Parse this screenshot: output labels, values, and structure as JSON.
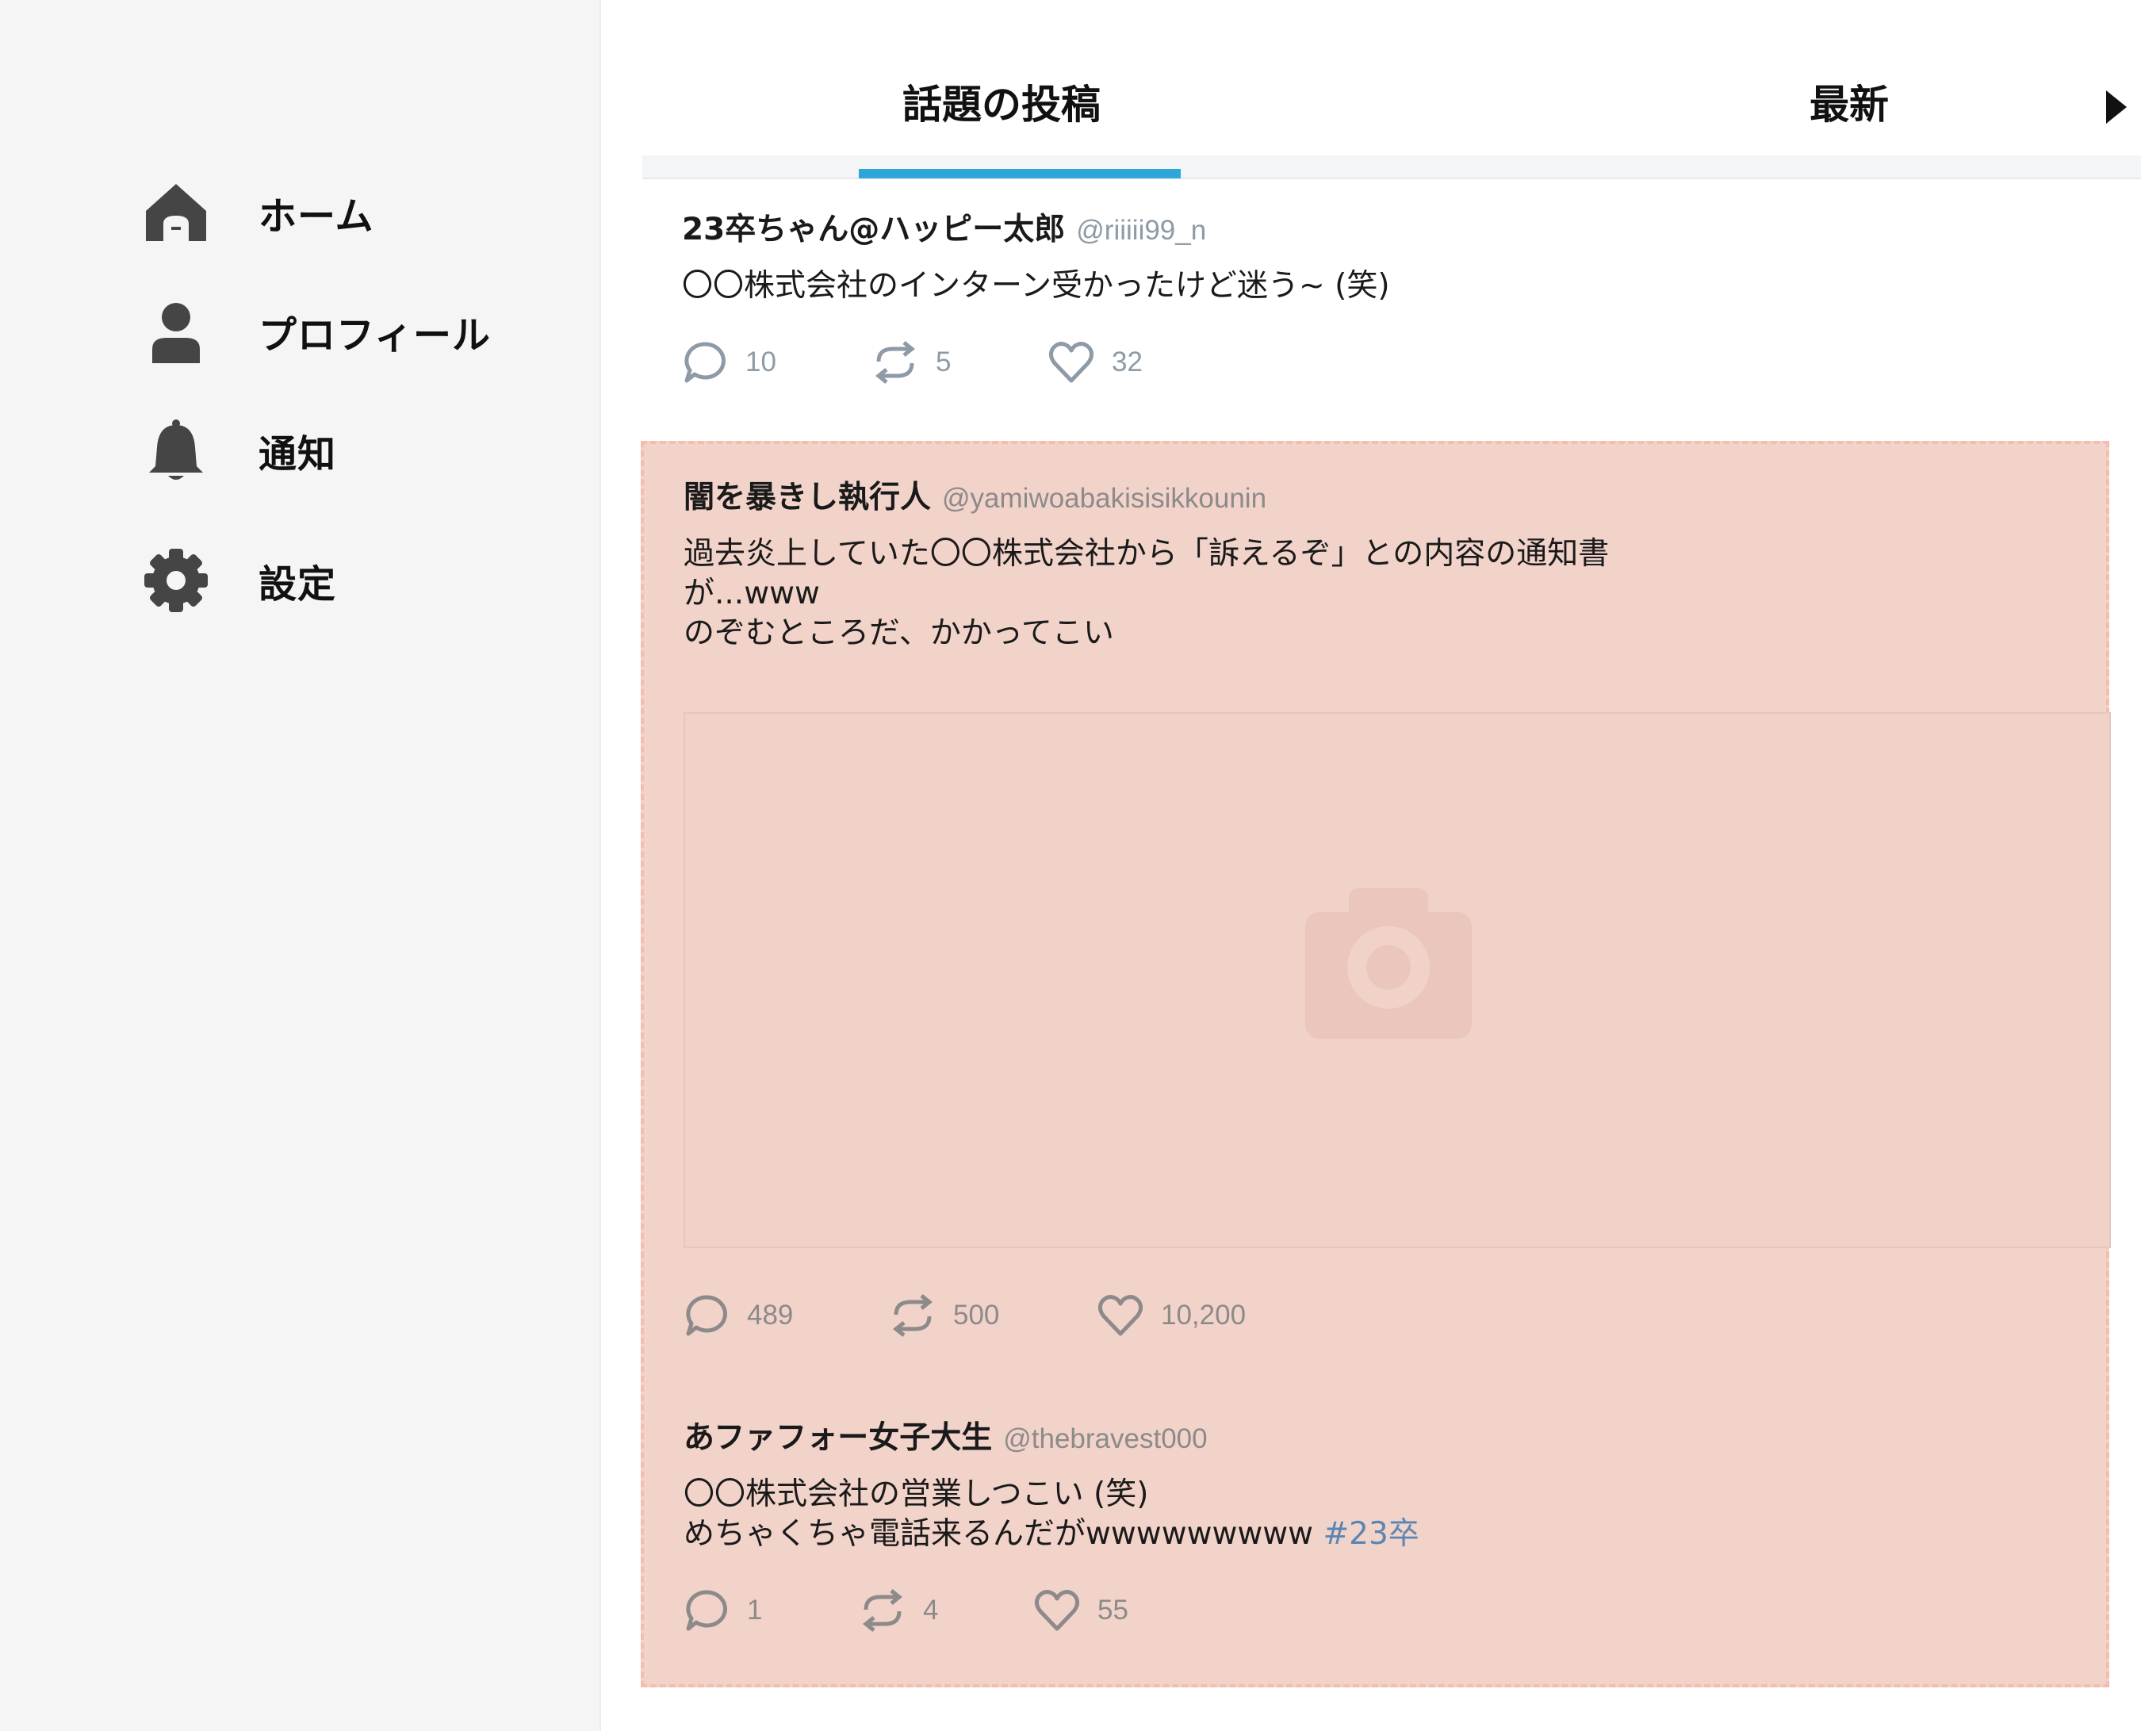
{
  "sidebar": {
    "items": [
      {
        "label": "ホーム",
        "icon": "home-icon"
      },
      {
        "label": "プロフィール",
        "icon": "user-icon"
      },
      {
        "label": "通知",
        "icon": "bell-icon"
      },
      {
        "label": "設定",
        "icon": "gear-icon"
      }
    ]
  },
  "tabs": [
    {
      "label": "話題の投稿",
      "active": true
    },
    {
      "label": "最新",
      "active": false
    }
  ],
  "posts": [
    {
      "name": "23卒ちゃん@ハッピー太郎",
      "handle": "@riiiii99_n",
      "body": "〇〇株式会社のインターン受かったけど迷う~ (笑)",
      "replies": "10",
      "reposts": "5",
      "likes": "32"
    },
    {
      "name": "闇を暴きし執行人",
      "handle": "@yamiwoabakisisikkounin",
      "body": "過去炎上していた〇〇株式会社から「訴えるぞ」との内容の通知書\nが...www\n のぞむところだ、かかってこい",
      "replies": "489",
      "reposts": "500",
      "likes": "10,200",
      "media": "camera-icon"
    },
    {
      "name": "あファフォー女子大生",
      "handle": "@thebravest000",
      "body": "〇〇株式会社の営業しつこい (笑)\nめちゃくちゃ電話来るんだがwwwwwwwww ",
      "hashtag": "#23卒",
      "replies": "1",
      "reposts": "4",
      "likes": "55"
    }
  ],
  "colors": {
    "accent": "#2ea6da",
    "highlight": "#f1d3ca",
    "icon_muted": "#8e9aa5"
  }
}
